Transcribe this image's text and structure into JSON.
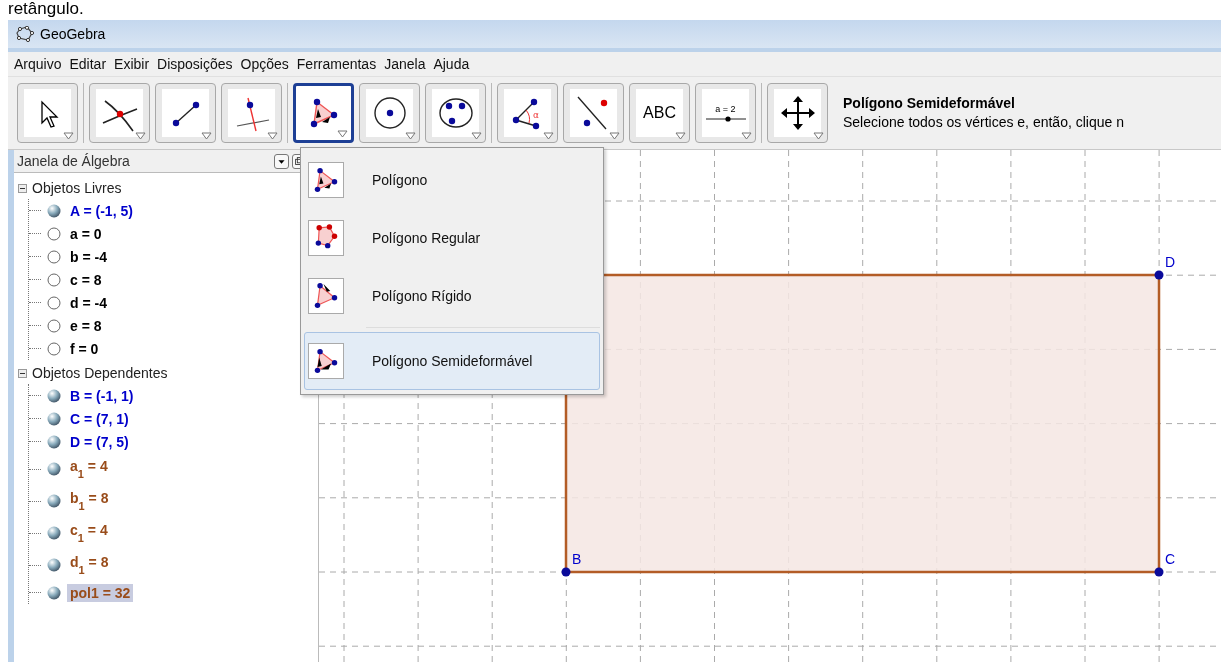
{
  "caption": "retângulo.",
  "window": {
    "title": "GeoGebra"
  },
  "menu": [
    "Arquivo",
    "Editar",
    "Exibir",
    "Disposições",
    "Opções",
    "Ferramentas",
    "Janela",
    "Ajuda"
  ],
  "toolbar": {
    "groups": [
      [
        {
          "kind": "move",
          "selected": false
        }
      ],
      [
        {
          "kind": "intersect",
          "selected": false
        },
        {
          "kind": "segment",
          "selected": false
        },
        {
          "kind": "perpendicular",
          "selected": false
        }
      ],
      [
        {
          "kind": "polygon",
          "selected": true
        },
        {
          "kind": "circle",
          "selected": false
        },
        {
          "kind": "conic",
          "selected": false
        }
      ],
      [
        {
          "kind": "angle",
          "label": "α",
          "selected": false
        },
        {
          "kind": "reflect",
          "selected": false
        },
        {
          "kind": "text",
          "label": "ABC",
          "selected": false
        },
        {
          "kind": "slider",
          "label": "a = 2",
          "selected": false
        }
      ],
      [
        {
          "kind": "move-view",
          "selected": false
        }
      ]
    ],
    "tool_title": "Polígono Semideformável",
    "tool_help": "Selecione todos os vértices e, então, clique n"
  },
  "algebra": {
    "title": "Janela de Álgebra",
    "tree": [
      {
        "label": "Objetos Livres",
        "expanded": true,
        "children": [
          {
            "label": "A = (-1, 5)",
            "visible": true,
            "color": "#0000cc",
            "selected": false
          },
          {
            "label": "a = 0",
            "visible": false,
            "color": "#000000",
            "selected": false
          },
          {
            "label": "b = -4",
            "visible": false,
            "color": "#000000",
            "selected": false
          },
          {
            "label": "c = 8",
            "visible": false,
            "color": "#000000",
            "selected": false
          },
          {
            "label": "d = -4",
            "visible": false,
            "color": "#000000",
            "selected": false
          },
          {
            "label": "e = 8",
            "visible": false,
            "color": "#000000",
            "selected": false
          },
          {
            "label": "f = 0",
            "visible": false,
            "color": "#000000",
            "selected": false
          }
        ]
      },
      {
        "label": "Objetos Dependentes",
        "expanded": true,
        "children": [
          {
            "label": "B = (-1, 1)",
            "visible": true,
            "color": "#0000cc",
            "selected": false
          },
          {
            "label": "C = (7, 1)",
            "visible": true,
            "color": "#0000cc",
            "selected": false
          },
          {
            "label": "D = (7, 5)",
            "visible": true,
            "color": "#0000cc",
            "selected": false
          },
          {
            "label": "a$_{1}$ = 4",
            "visible": true,
            "color": "#994c1a",
            "selected": false
          },
          {
            "label": "b$_{1}$ = 8",
            "visible": true,
            "color": "#994c1a",
            "selected": false
          },
          {
            "label": "c$_{1}$ = 4",
            "visible": true,
            "color": "#994c1a",
            "selected": false
          },
          {
            "label": "d$_{1}$ = 8",
            "visible": true,
            "color": "#994c1a",
            "selected": false
          },
          {
            "label": "pol1 = 32",
            "visible": true,
            "color": "#994c1a",
            "selected": true
          }
        ]
      }
    ]
  },
  "popup": [
    {
      "kind": "polygon",
      "label": "Polígono",
      "selected": false
    },
    {
      "kind": "regular",
      "label": "Polígono Regular",
      "selected": false
    },
    {
      "kind": "rigid",
      "label": "Polígono Rígido",
      "selected": false
    },
    {
      "kind": "vector",
      "label": "Polígono Semideformável",
      "selected": true
    }
  ],
  "graphics": {
    "points": [
      {
        "label": "D"
      },
      {
        "label": "B"
      },
      {
        "label": "C"
      }
    ]
  }
}
